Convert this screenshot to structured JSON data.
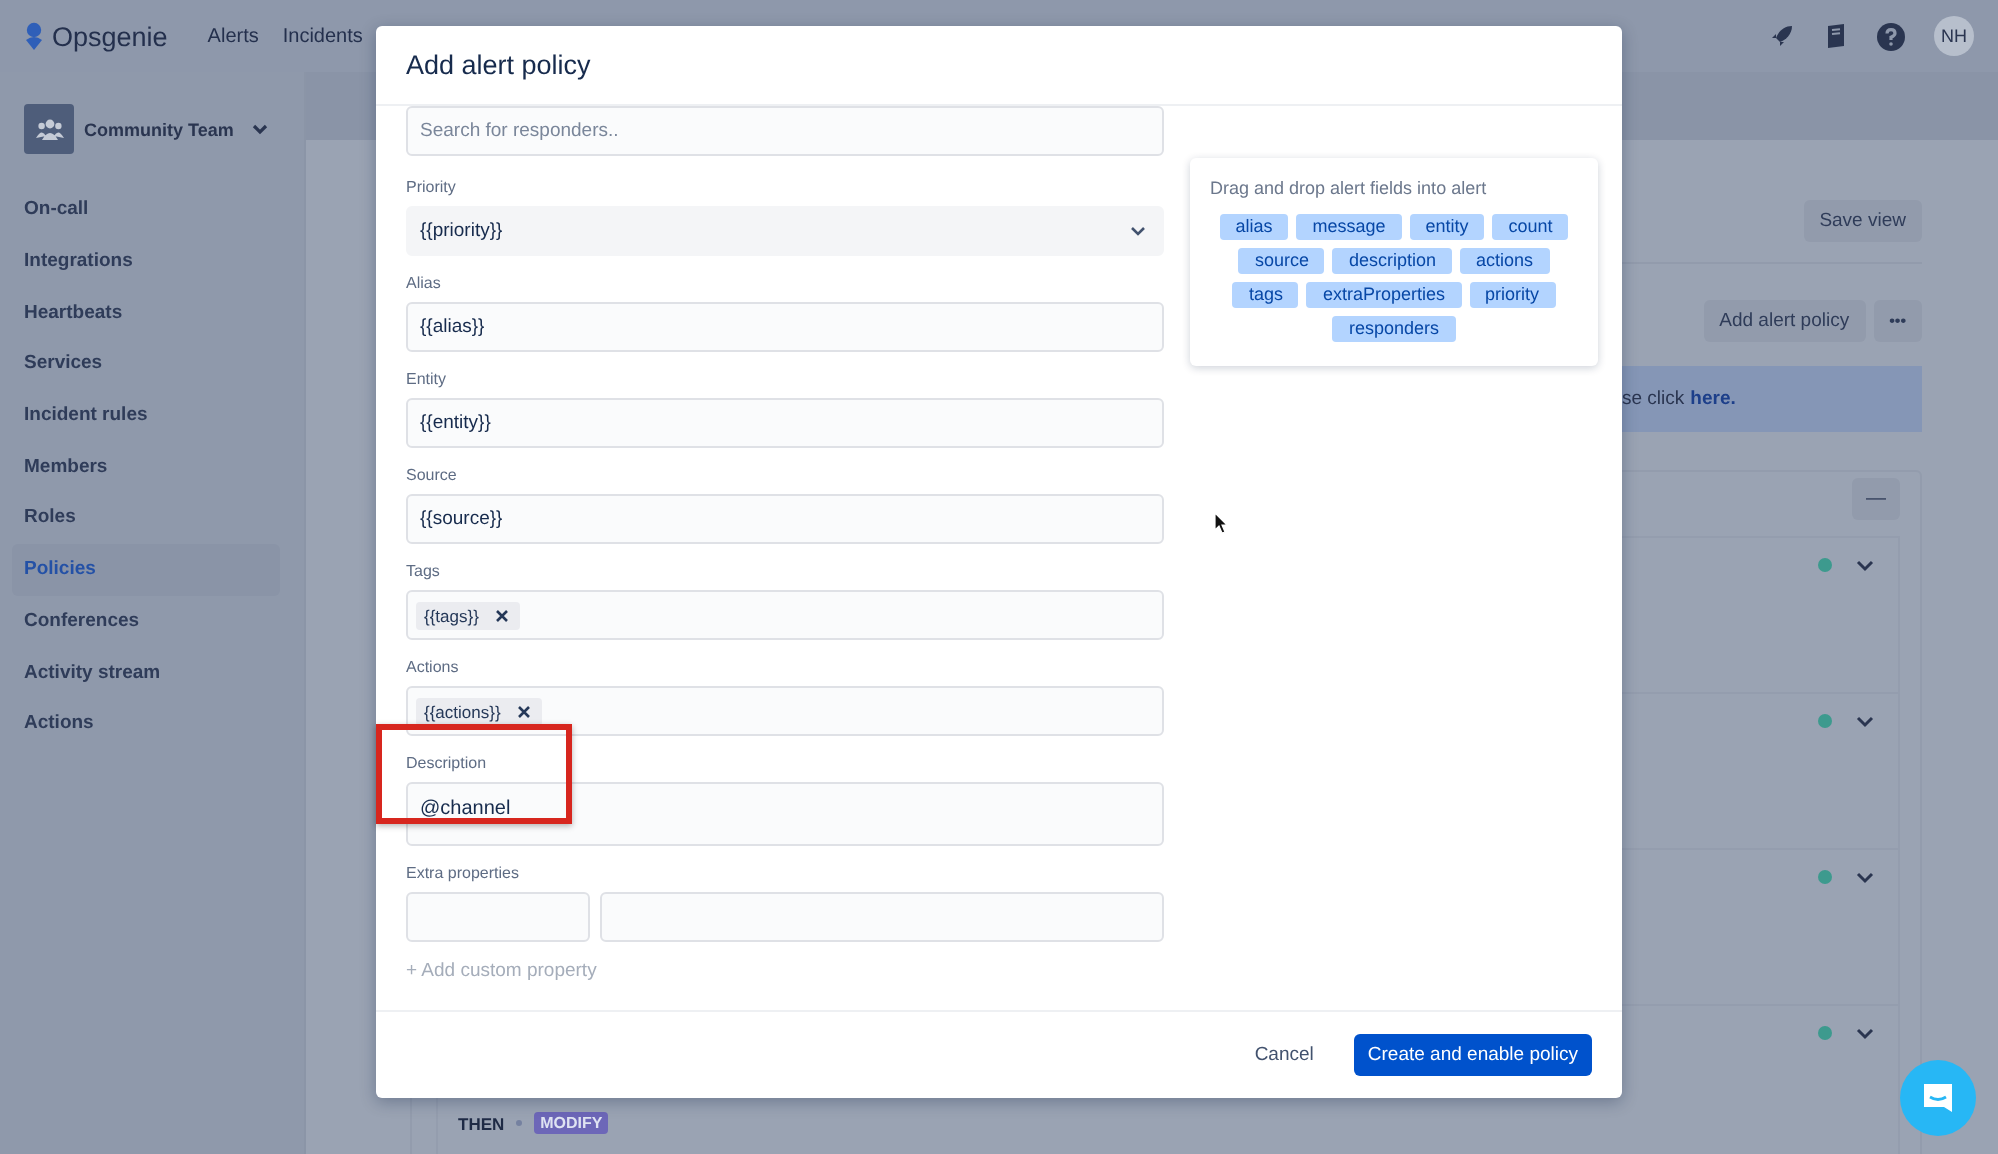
{
  "app": {
    "name": "Opsgenie"
  },
  "nav": [
    {
      "label": "Alerts"
    },
    {
      "label": "Incidents"
    }
  ],
  "user": {
    "initials": "NH"
  },
  "team": {
    "name": "Community Team"
  },
  "sidebar": {
    "items": [
      {
        "label": "On-call",
        "selected": false
      },
      {
        "label": "Integrations",
        "selected": false
      },
      {
        "label": "Heartbeats",
        "selected": false
      },
      {
        "label": "Services",
        "selected": false
      },
      {
        "label": "Incident rules",
        "selected": false
      },
      {
        "label": "Members",
        "selected": false
      },
      {
        "label": "Roles",
        "selected": false
      },
      {
        "label": "Policies",
        "selected": true
      },
      {
        "label": "Conferences",
        "selected": false
      },
      {
        "label": "Activity stream",
        "selected": false
      },
      {
        "label": "Actions",
        "selected": false
      }
    ]
  },
  "page": {
    "save_view": "Save view",
    "add_policy": "Add alert policy",
    "more": "•••",
    "banner": {
      "text": "se click",
      "link": "here."
    },
    "collapse": "—",
    "policies": [
      {
        "enabled": true
      },
      {
        "enabled": true
      },
      {
        "enabled": true
      },
      {
        "enabled": true
      }
    ],
    "then": "THEN",
    "action": "MODIFY"
  },
  "modal": {
    "title": "Add alert policy",
    "fields": [
      {
        "kind": "search",
        "placeholder": "Search for responders.."
      },
      {
        "kind": "select",
        "label": "Priority",
        "value": "{{priority}}"
      },
      {
        "kind": "text",
        "label": "Alias",
        "value": "{{alias}}"
      },
      {
        "kind": "text",
        "label": "Entity",
        "value": "{{entity}}"
      },
      {
        "kind": "text",
        "label": "Source",
        "value": "{{source}}"
      },
      {
        "kind": "tags",
        "label": "Tags",
        "tags": [
          "{{tags}}"
        ]
      },
      {
        "kind": "tags",
        "label": "Actions",
        "tags": [
          "{{actions}}"
        ]
      },
      {
        "kind": "textarea",
        "label": "Description",
        "value": "@channel",
        "highlighted": true
      },
      {
        "kind": "pair",
        "label": "Extra properties"
      }
    ],
    "add_property": "+ Add custom property",
    "palette": {
      "title": "Drag and drop alert fields into alert",
      "chips": [
        "alias",
        "message",
        "entity",
        "count",
        "source",
        "description",
        "actions",
        "tags",
        "extraProperties",
        "priority",
        "responders"
      ]
    },
    "buttons": [
      {
        "label": "Cancel",
        "kind": "subtle"
      },
      {
        "label": "Create and enable policy",
        "kind": "primary"
      }
    ]
  }
}
